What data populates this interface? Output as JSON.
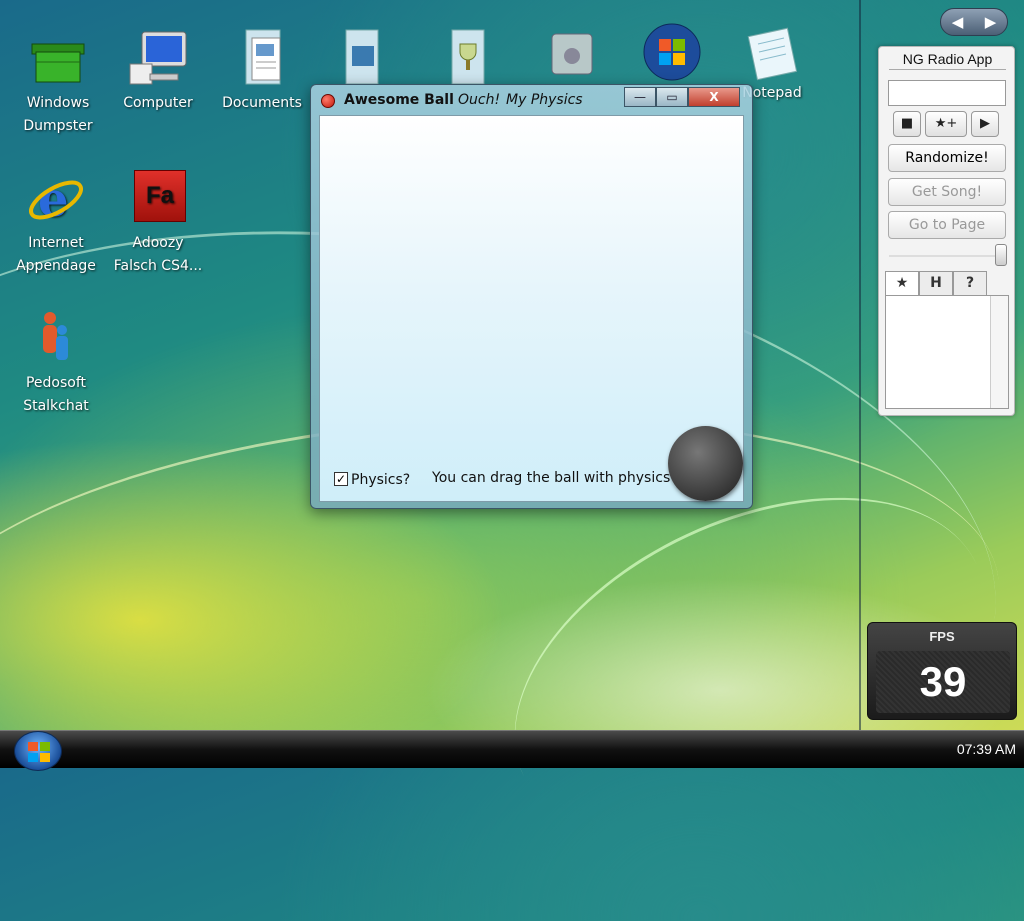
{
  "desktop": {
    "icons": [
      {
        "label": "Windows\nDumpster",
        "line1": "Windows",
        "line2": "Dumpster",
        "icon": "dumpster-icon"
      },
      {
        "label": "Computer",
        "line1": "Computer",
        "line2": "",
        "icon": "computer-icon"
      },
      {
        "label": "Documents",
        "line1": "Documents",
        "line2": "",
        "icon": "documents-icon"
      },
      {
        "label": "Notepad",
        "line1": "Notepad",
        "line2": "",
        "icon": "notepad-icon"
      },
      {
        "label": "Internet Appendage",
        "line1": "Internet",
        "line2": "Appendage",
        "icon": "ie-icon"
      },
      {
        "label": "Adoozy Falsch CS4...",
        "line1": "Adoozy",
        "line2": "Falsch CS4...",
        "icon": "flash-icon",
        "badge": "Fa"
      },
      {
        "label": "Pedosoft Stalkchat",
        "line1": "Pedosoft",
        "line2": "Stalkchat",
        "icon": "messenger-icon"
      }
    ]
  },
  "window": {
    "title": "Awesome Ball",
    "subtitle1": "Ouch!",
    "subtitle2": "My Physics",
    "minimize_label": "—",
    "maximize_label": "▭",
    "close_label": "X",
    "checkbox_label": "Physics?",
    "checkbox_checked": true,
    "hint_text": "You can drag the ball with physics"
  },
  "sidebar": {
    "nav_prev": "◀",
    "nav_next": "▶",
    "radio": {
      "title": "NG Radio App",
      "stop_label": "■",
      "fav_label": "★+",
      "play_label": "▶",
      "randomize_label": "Randomize!",
      "get_song_label": "Get Song!",
      "go_to_page_label": "Go to Page",
      "tabs": [
        "★",
        "H",
        "?"
      ]
    },
    "fps": {
      "label": "FPS",
      "value": "39"
    }
  },
  "taskbar": {
    "clock": "07:39 AM"
  },
  "colors": {
    "window_close": "#c0402e",
    "ball": "#444444"
  }
}
